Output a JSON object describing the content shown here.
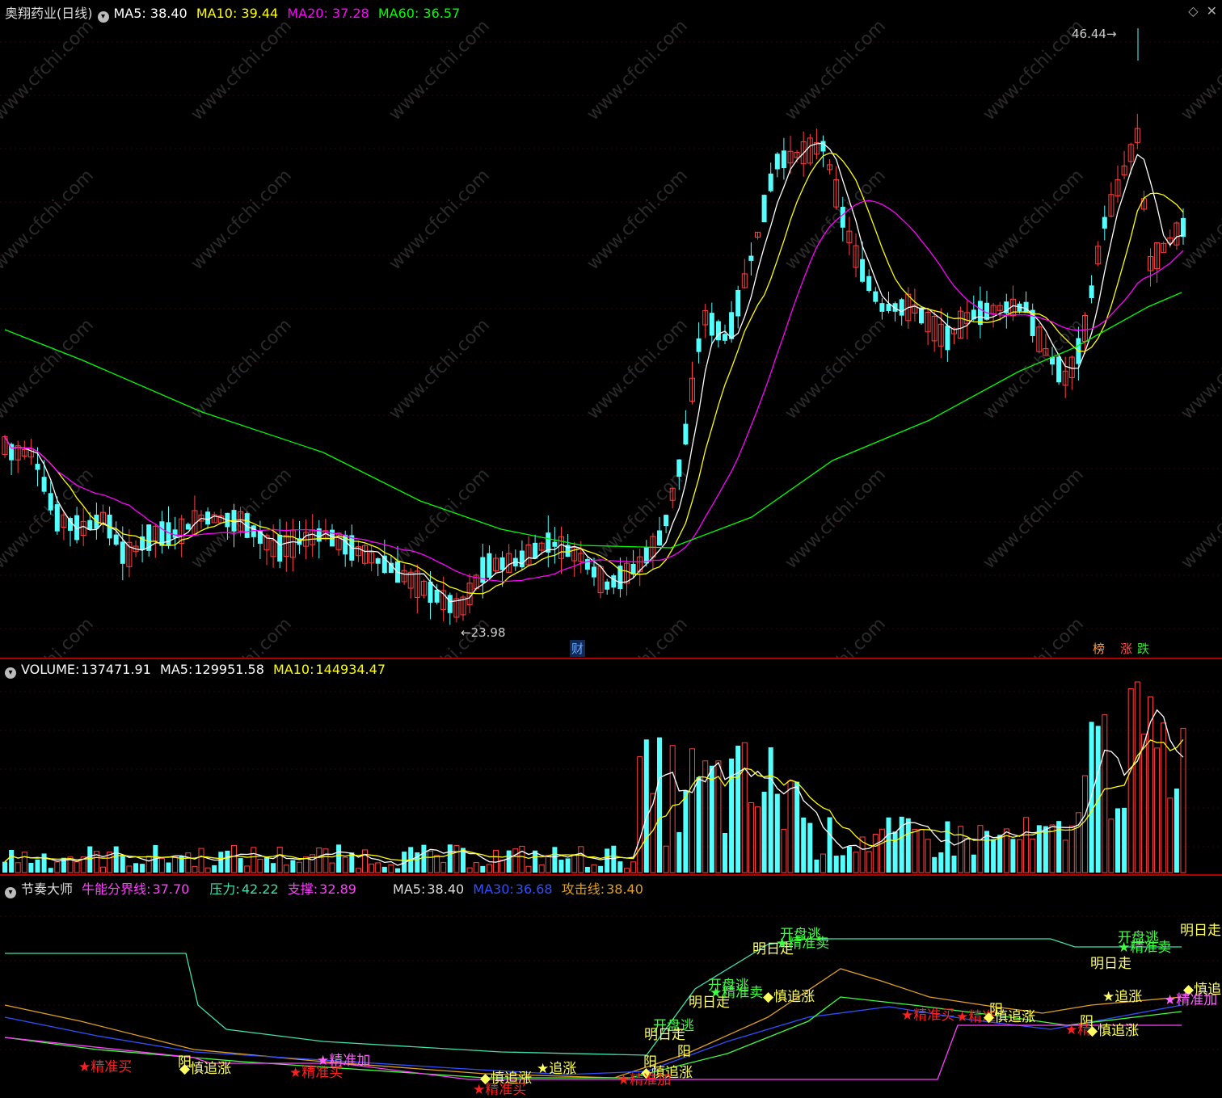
{
  "price_panel": {
    "stock_name": "奥翔药业(日线)",
    "ma5_label": "MA5:",
    "ma5_value": "38.40",
    "ma5_color": "#ffffff",
    "ma10_label": "MA10:",
    "ma10_value": "39.44",
    "ma10_color": "#ffff00",
    "ma20_label": "MA20:",
    "ma20_value": "37.28",
    "ma20_color": "#ff00ff",
    "ma60_label": "MA60:",
    "ma60_value": "36.57",
    "ma60_color": "#00ff00",
    "high_label": "46.44",
    "low_label": "23.98",
    "event_badges": [
      "财",
      "榜",
      "涨",
      "跌"
    ]
  },
  "volume_panel": {
    "title": "VOLUME:",
    "value": "137471.91",
    "ma5_label": "MA5:",
    "ma5_value": "129951.58",
    "ma10_label": "MA10:",
    "ma10_value": "144934.47"
  },
  "indicator_panel": {
    "name": "节奏大师",
    "niuneng_label": "牛能分界线:",
    "niuneng_value": "37.70",
    "pressure_label": "压力:",
    "pressure_value": "42.22",
    "support_label": "支撑:",
    "support_value": "32.89",
    "ma5_label": "MA5:",
    "ma5_value": "38.40",
    "ma30_label": "MA30:",
    "ma30_value": "36.68",
    "attack_label": "攻击线:",
    "attack_value": "38.40",
    "signals": [
      {
        "text": "★精准买",
        "color": "#ff2020"
      },
      {
        "text": "阳",
        "color": "#ffff60"
      },
      {
        "text": "◆慎追涨",
        "color": "#ffff60"
      },
      {
        "text": "★精准加",
        "color": "#ff60ff"
      },
      {
        "text": "★精准买",
        "color": "#ff2020"
      },
      {
        "text": "◆慎追涨",
        "color": "#ffff60"
      },
      {
        "text": "★精准买",
        "color": "#ff2020"
      },
      {
        "text": "★追涨",
        "color": "#ffff60"
      },
      {
        "text": "阳",
        "color": "#ffff60"
      },
      {
        "text": "◆慎追涨",
        "color": "#ffff60"
      },
      {
        "text": "★精准加",
        "color": "#ff2020"
      },
      {
        "text": "开盘逃",
        "color": "#40ff40"
      },
      {
        "text": "明日走",
        "color": "#ffff60"
      },
      {
        "text": "阳",
        "color": "#ffff60"
      },
      {
        "text": "明日走",
        "color": "#ffff60"
      },
      {
        "text": "开盘逃",
        "color": "#40ff40"
      },
      {
        "text": "★精准卖",
        "color": "#40ff40"
      },
      {
        "text": "◆慎追涨",
        "color": "#ffff60"
      },
      {
        "text": "明日走",
        "color": "#ffff60"
      },
      {
        "text": "开盘逃",
        "color": "#40ff40"
      },
      {
        "text": "★精准卖",
        "color": "#40ff40"
      },
      {
        "text": "★精准买",
        "color": "#ff2020"
      },
      {
        "text": "★精准",
        "color": "#ff2020"
      },
      {
        "text": "◆慎追涨",
        "color": "#ffff60"
      },
      {
        "text": "阳",
        "color": "#ffff60"
      },
      {
        "text": "阳",
        "color": "#ffff60"
      },
      {
        "text": "★追涨",
        "color": "#ffff60"
      },
      {
        "text": "★精",
        "color": "#ff2020"
      },
      {
        "text": "◆慎追涨",
        "color": "#ffff60"
      },
      {
        "text": "明日走",
        "color": "#ffff60"
      },
      {
        "text": "开盘逃",
        "color": "#40ff40"
      },
      {
        "text": "★精准卖",
        "color": "#40ff40"
      },
      {
        "text": "明日走",
        "color": "#ffff60"
      },
      {
        "text": "◆慎追",
        "color": "#ffff60"
      },
      {
        "text": "★精准加",
        "color": "#ff60ff"
      }
    ]
  },
  "watermark": "www.cfchi.com"
}
